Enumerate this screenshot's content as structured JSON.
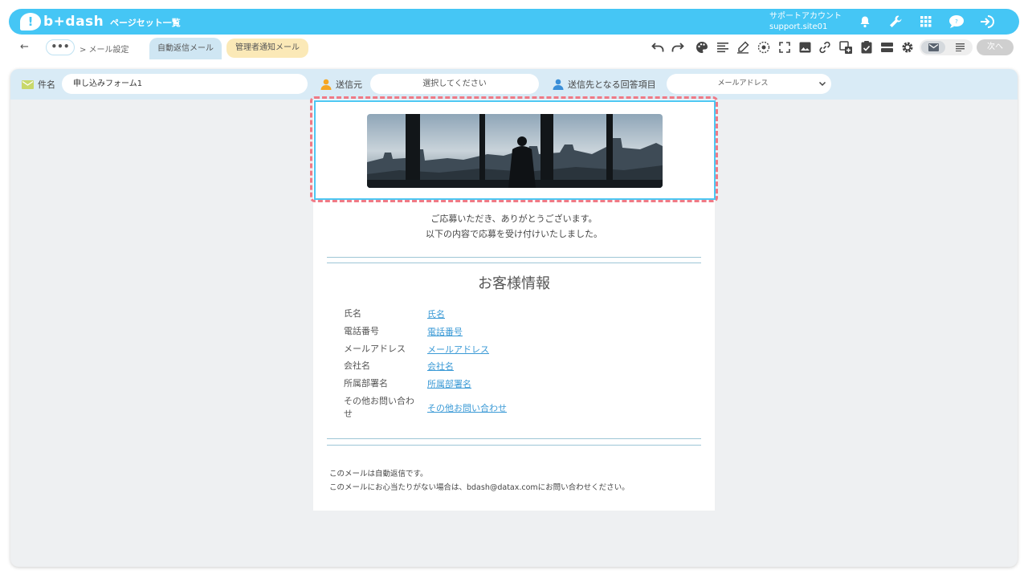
{
  "header": {
    "logo_text": "b+dash",
    "logo_mark": "!",
    "page_list_label": "ページセット一覧",
    "account_label": "サポートアカウント",
    "account_site": "support.site01",
    "icons": [
      "bell-icon",
      "wrench-icon",
      "grid-icon",
      "chat-icon",
      "logout-icon"
    ]
  },
  "toolbar": {
    "back_icon": "←",
    "more_label": "•••",
    "breadcrumb": "> メール設定",
    "tabs": [
      {
        "label": "自動返信メール",
        "active": true
      },
      {
        "label": "管理者通知メール",
        "active": false
      }
    ],
    "tools": [
      "undo-icon",
      "redo-icon",
      "palette-icon",
      "align-icon",
      "pen-icon",
      "target-icon",
      "fullscreen-icon",
      "image-icon",
      "link-icon",
      "insert-icon",
      "check-icon",
      "block-icon",
      "settings-icon"
    ],
    "next_label": "次へ"
  },
  "fields": {
    "subject_label": "件名",
    "subject_value": "申し込みフォーム1",
    "sender_label": "送信元",
    "sender_placeholder": "選択してください",
    "recipient_label": "送信先となる回答項目",
    "recipient_value": "メールアドレス"
  },
  "email": {
    "thanks_line1": "ご応募いただき、ありがとうございます。",
    "thanks_line2": "以下の内容で応募を受け付けいたしました。",
    "section_title": "お客様情報",
    "rows": [
      {
        "key": "氏名",
        "value": "氏名"
      },
      {
        "key": "電話番号",
        "value": "電話番号"
      },
      {
        "key": "メールアドレス",
        "value": "メールアドレス"
      },
      {
        "key": "会社名",
        "value": "会社名"
      },
      {
        "key": "所属部署名",
        "value": "所属部署名"
      },
      {
        "key": "その他お問い合わせ",
        "value": "その他お問い合わせ"
      }
    ],
    "footer_line1": "このメールは自動返信です。",
    "footer_line2": "このメールにお心当たりがない場合は、bdash@datax.comにお問い合わせください。"
  },
  "colors": {
    "brand": "#45c6f5",
    "selection_dash": "#f07a86",
    "link": "#3b9ad6"
  }
}
